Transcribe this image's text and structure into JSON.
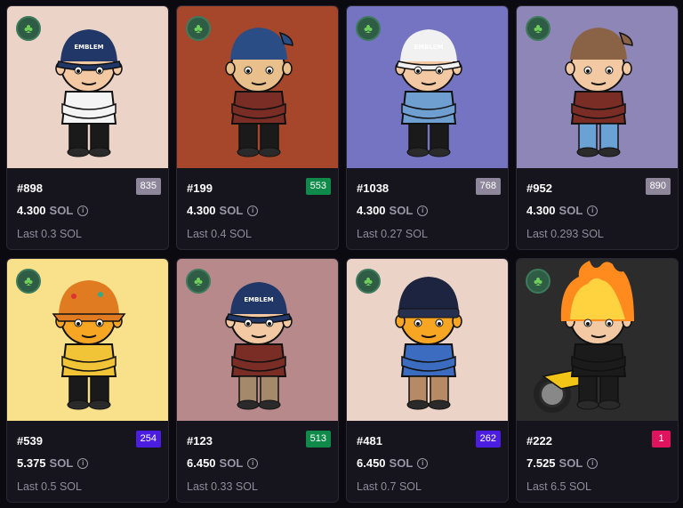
{
  "colors": {
    "page_bg": "#0b0a10",
    "card_bg": "#16141d",
    "muted_text": "#8f8d9b"
  },
  "cards": [
    {
      "token": "#898",
      "rank": "835",
      "rank_color": "#8e879c",
      "price": "4.300",
      "unit": "SOL",
      "last": "Last 0.3 SOL",
      "bg": "#ecd3c8",
      "hat": "#203768",
      "cap_style": "cap",
      "skin": "#f2c9a3",
      "shirt": "#f4f4f4",
      "pants": "#1a1a1a",
      "badge_icon": "clover-icon"
    },
    {
      "token": "#199",
      "rank": "553",
      "rank_color": "#0f8a4a",
      "price": "4.300",
      "unit": "SOL",
      "last": "Last 0.4 SOL",
      "bg": "#a6472b",
      "hat": "#2b4d86",
      "cap_style": "backcap",
      "skin": "#e9c08b",
      "shirt": "#7a2d24",
      "pants": "#1a1a1a",
      "badge_icon": "clover-icon"
    },
    {
      "token": "#1038",
      "rank": "768",
      "rank_color": "#8e879c",
      "price": "4.300",
      "unit": "SOL",
      "last": "Last 0.27 SOL",
      "bg": "#7474c2",
      "hat": "#f1f1f1",
      "cap_style": "cap",
      "skin": "#f2c9a3",
      "shirt": "#6f9fd0",
      "pants": "#1a1a1a",
      "badge_icon": "clover-icon"
    },
    {
      "token": "#952",
      "rank": "890",
      "rank_color": "#8e879c",
      "price": "4.300",
      "unit": "SOL",
      "last": "Last 0.293 SOL",
      "bg": "#8f86b8",
      "hat": "#8a6347",
      "cap_style": "backcap",
      "skin": "#f2c9a3",
      "shirt": "#7a2d24",
      "pants": "#6aa2d6",
      "badge_icon": "clover-icon"
    },
    {
      "token": "#539",
      "rank": "254",
      "rank_color": "#4a1de0",
      "price": "5.375",
      "unit": "SOL",
      "last": "Last 0.5 SOL",
      "bg": "#f9e08a",
      "hat": "#e07b22",
      "cap_style": "bucket",
      "skin": "#f6a623",
      "shirt": "#f0c436",
      "pants": "#1a1a1a",
      "badge_icon": "clover-icon"
    },
    {
      "token": "#123",
      "rank": "513",
      "rank_color": "#0f8a4a",
      "price": "6.450",
      "unit": "SOL",
      "last": "Last 0.33 SOL",
      "bg": "#b8898a",
      "hat": "#203768",
      "cap_style": "cap",
      "skin": "#f2c9a3",
      "shirt": "#7a2d24",
      "pants": "#a48a6a",
      "badge_icon": "clover-icon"
    },
    {
      "token": "#481",
      "rank": "262",
      "rank_color": "#4a1de0",
      "price": "6.450",
      "unit": "SOL",
      "last": "Last 0.7 SOL",
      "bg": "#ecd3c8",
      "hat": "#1c2440",
      "cap_style": "beanie",
      "skin": "#f6a623",
      "shirt": "#3b6cc0",
      "pants": "#b78a66",
      "badge_icon": "clover-icon"
    },
    {
      "token": "#222",
      "rank": "1",
      "rank_color": "#e0135e",
      "price": "7.525",
      "unit": "SOL",
      "last": "Last 6.5 SOL",
      "bg": "#2c2c2c",
      "hat": "#ff8a1e",
      "cap_style": "fire",
      "skin": "#f2c9a3",
      "shirt": "#1b1b1b",
      "pants": "#1b1b1b",
      "badge_icon": "clover-icon"
    }
  ]
}
